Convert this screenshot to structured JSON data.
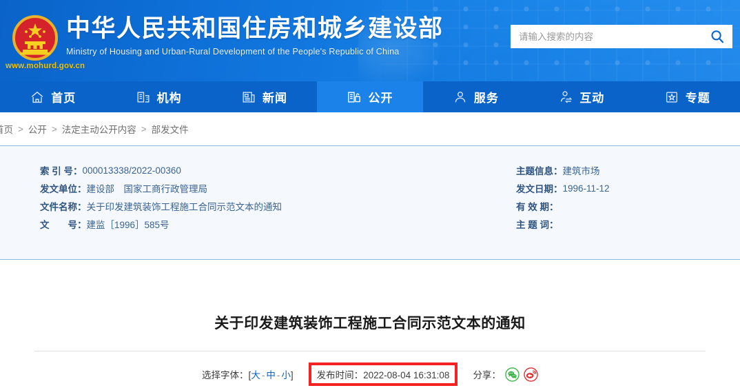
{
  "header": {
    "emblem_icon": "china-national-emblem",
    "title_cn": "中华人民共和国住房和城乡建设部",
    "title_en": "Ministry of Housing and Urban-Rural Development of the People's Republic of China",
    "website_url": "www.mohurd.gov.cn",
    "search": {
      "placeholder": "请输入搜索的内容",
      "value": "",
      "button_icon": "search-icon"
    },
    "brand_blue": "#0d6ed6",
    "accent_yellow": "#f2c200"
  },
  "nav": {
    "active_bg": "#1a82e8",
    "items": [
      {
        "label": "首页",
        "icon": "home-icon",
        "active": false
      },
      {
        "label": "机构",
        "icon": "building-icon",
        "active": false
      },
      {
        "label": "新闻",
        "icon": "newspaper-icon",
        "active": false
      },
      {
        "label": "公开",
        "icon": "open-folder-icon",
        "active": true
      },
      {
        "label": "服务",
        "icon": "user-service-icon",
        "active": false
      },
      {
        "label": "互动",
        "icon": "interaction-icon",
        "active": false
      },
      {
        "label": "专题",
        "icon": "star-topic-icon",
        "active": false
      }
    ]
  },
  "breadcrumb": {
    "separator": ">",
    "items": [
      "首页",
      "公开",
      "法定主动公开内容",
      "部发文件"
    ]
  },
  "meta": {
    "border_color": "#8cb8e4",
    "bg_color": "#f5f9fe",
    "rows": [
      {
        "key": "索 引 号：",
        "value": "000013338/2022-00360"
      },
      {
        "key": "主题信息：",
        "value": "建筑市场"
      },
      {
        "key": "发文单位：",
        "value": "建设部　国家工商行政管理局"
      },
      {
        "key": "发文日期：",
        "value": "1996-11-12"
      },
      {
        "key": "文件名称：",
        "value": "关于印发建筑装饰工程施工合同示范文本的通知"
      },
      {
        "key": "有 效 期：",
        "value": ""
      },
      {
        "key": "文　　号：",
        "value": "建监［1996］585号"
      },
      {
        "key": "主 题 词：",
        "value": ""
      }
    ]
  },
  "article": {
    "title": "关于印发建筑装饰工程施工合同示范文本的通知",
    "font_select": {
      "label": "选择字体：",
      "bracket_open": "[",
      "bracket_close": "]",
      "dash": "-",
      "options": [
        "大",
        "中",
        "小"
      ]
    },
    "publish_time": {
      "label": "发布时间：",
      "value": "2022-08-04 16:31:08",
      "highlight_color": "#f62121"
    },
    "share": {
      "label": "分享：",
      "icons": [
        {
          "name": "wechat-share-icon",
          "color": "#3db34a"
        },
        {
          "name": "weibo-share-icon",
          "color": "#e3282f"
        }
      ]
    }
  }
}
